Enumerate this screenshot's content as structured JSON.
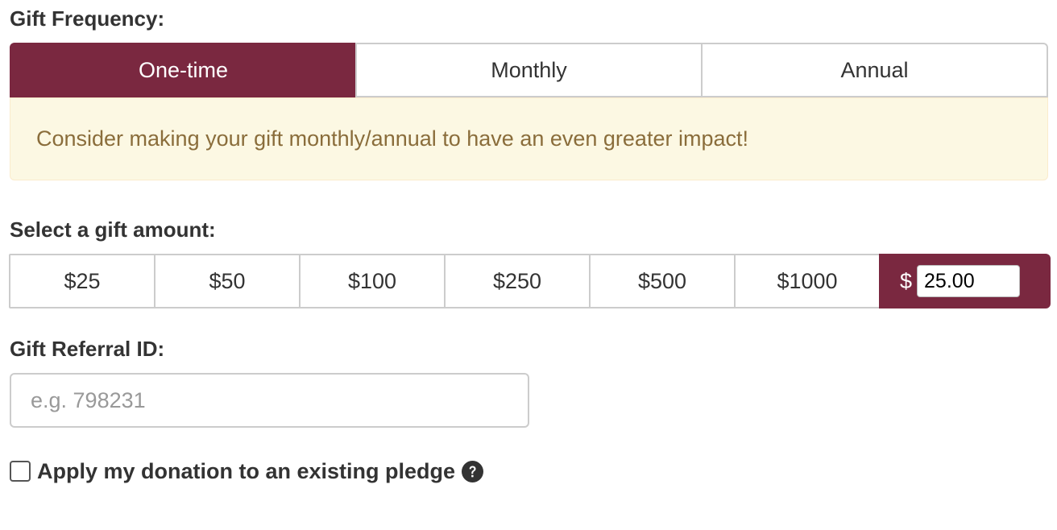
{
  "frequency": {
    "label": "Gift Frequency:",
    "options": [
      {
        "label": "One-time",
        "active": true
      },
      {
        "label": "Monthly",
        "active": false
      },
      {
        "label": "Annual",
        "active": false
      }
    ]
  },
  "alert": {
    "text": "Consider making your gift monthly/annual to have an even greater impact!"
  },
  "amount": {
    "label": "Select a gift amount:",
    "options": [
      "$25",
      "$50",
      "$100",
      "$250",
      "$500",
      "$1000"
    ],
    "custom": {
      "currency_symbol": "$",
      "value": "25.00"
    }
  },
  "referral": {
    "label": "Gift Referral ID:",
    "placeholder": "e.g. 798231",
    "value": ""
  },
  "pledge": {
    "label": "Apply my donation to an existing pledge",
    "checked": false,
    "help_icon": "question-circle-icon"
  },
  "colors": {
    "accent": "#7a2840",
    "alert_background": "#fcf8e3",
    "alert_text": "#8a6d3b",
    "border": "#cccccc"
  }
}
